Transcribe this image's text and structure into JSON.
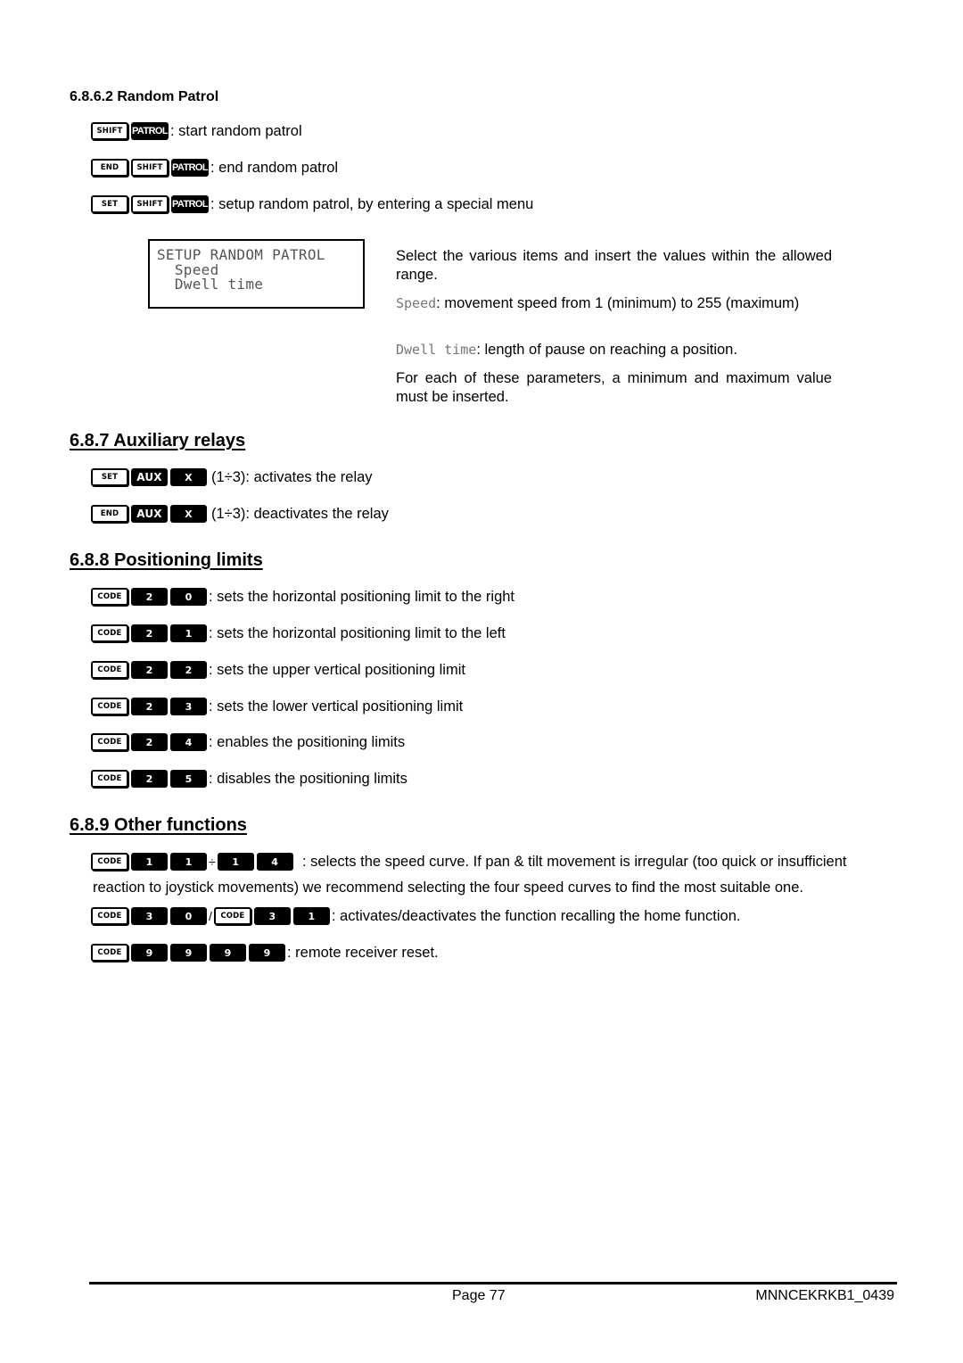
{
  "section_6862": {
    "title": "6.8.6.2 Random Patrol",
    "items": [
      {
        "keys": [
          "SHIFT",
          "PATROL"
        ],
        "desc": ": start random patrol"
      },
      {
        "keys": [
          "END",
          "SHIFT",
          "PATROL"
        ],
        "desc": ": end random patrol"
      },
      {
        "keys": [
          "SET",
          "SHIFT",
          "PATROL"
        ],
        "desc": ": setup random patrol, by entering a special menu"
      }
    ],
    "lcd": {
      "line1": "SETUP RANDOM PATROL",
      "line2": "  Speed",
      "line3": "  Dwell time"
    },
    "para1": "Select the various items and insert the values within the allowed range.",
    "speed_label": "Speed",
    "speed_desc": ": movement speed from 1 (minimum) to 255 (maximum)",
    "dwell_label": "Dwell time",
    "dwell_desc": ": length of pause on reaching a position.",
    "para4": "For each of these parameters, a minimum and maximum value must be inserted."
  },
  "section_687": {
    "title": "6.8.7 Auxiliary relays",
    "items": [
      {
        "keys": [
          "SET",
          "AUX",
          "X"
        ],
        "desc": "(1÷3): activates the relay"
      },
      {
        "keys": [
          "END",
          "AUX",
          "X"
        ],
        "desc": "(1÷3): deactivates the relay"
      }
    ]
  },
  "section_688": {
    "title": "6.8.8 Positioning limits",
    "items": [
      {
        "keys": [
          "CODE",
          "2",
          "0"
        ],
        "desc": ": sets the horizontal positioning limit to the right"
      },
      {
        "keys": [
          "CODE",
          "2",
          "1"
        ],
        "desc": ": sets the horizontal positioning limit to the left"
      },
      {
        "keys": [
          "CODE",
          "2",
          "2"
        ],
        "desc": ": sets the upper vertical positioning limit"
      },
      {
        "keys": [
          "CODE",
          "2",
          "3"
        ],
        "desc": ": sets the lower vertical positioning limit"
      },
      {
        "keys": [
          "CODE",
          "2",
          "4"
        ],
        "desc": ": enables the positioning limits"
      },
      {
        "keys": [
          "CODE",
          "2",
          "5"
        ],
        "desc": ": disables the positioning limits"
      }
    ]
  },
  "section_689": {
    "title": "6.8.9 Other functions",
    "speed_curve": {
      "keys_a": [
        "CODE",
        "1",
        "1"
      ],
      "range_sep": "÷",
      "keys_b": [
        "1",
        "4"
      ],
      "desc": ": selects the speed curve. If pan & tilt movement is irregular (too quick or insufficient reaction to joystick movements) we recommend selecting the four speed curves to find the most suitable one."
    },
    "home": {
      "keys_a": [
        "CODE",
        "3",
        "0"
      ],
      "sep": "/",
      "keys_b": [
        "CODE",
        "3",
        "1"
      ],
      "desc": ": activates/deactivates the function recalling the home function."
    },
    "reset": {
      "keys": [
        "CODE",
        "9",
        "9",
        "9",
        "9"
      ],
      "desc": ": remote receiver reset."
    }
  },
  "footer": {
    "page": "Page 77",
    "doc_code": "MNNCEKRKB1_0439"
  }
}
